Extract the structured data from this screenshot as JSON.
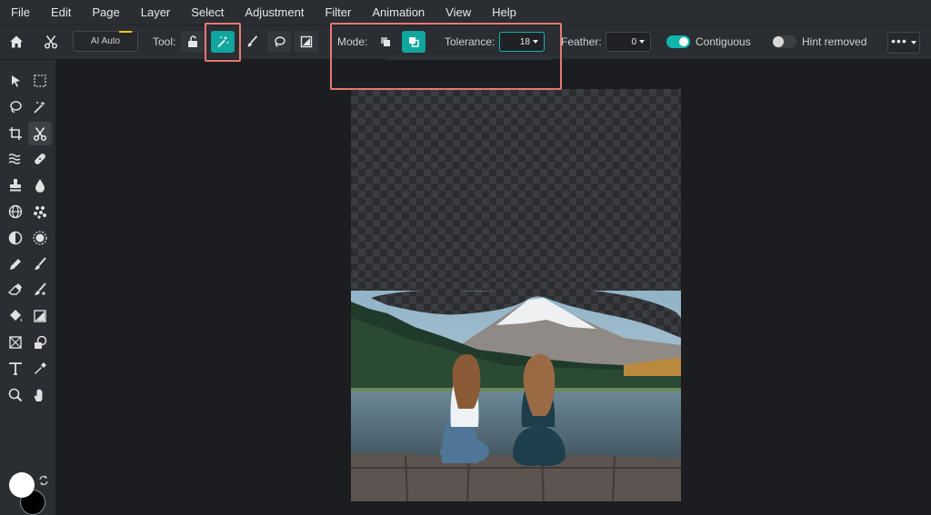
{
  "menu": [
    "File",
    "Edit",
    "Page",
    "Layer",
    "Select",
    "Adjustment",
    "Filter",
    "Animation",
    "View",
    "Help"
  ],
  "toolbar": {
    "ai_auto_label": "AI Auto",
    "tool_label": "Tool:",
    "mode_label": "Mode:",
    "tolerance_label": "Tolerance:",
    "tolerance_value": "18",
    "tolerance_max": 100,
    "feather_label": "Feather:",
    "feather_value": "0",
    "contiguous_label": "Contiguous",
    "contiguous_on": true,
    "hint_removed_label": "Hint removed",
    "hint_removed_on": false
  },
  "colors": {
    "accent": "#12b5ad",
    "highlight": "#e57a72",
    "foreground_swatch": "#ffffff",
    "background_swatch": "#000000"
  },
  "left_tools": [
    [
      "move-tool-icon",
      "marquee-select-icon"
    ],
    [
      "lasso-select-icon",
      "magic-wand-icon"
    ],
    [
      "crop-icon",
      "cutout-scissors-icon"
    ],
    [
      "liquify-icon",
      "healing-bandage-icon"
    ],
    [
      "clone-stamp-icon",
      "blur-drop-icon"
    ],
    [
      "filter-globe-icon",
      "effects-dots-icon"
    ],
    [
      "dodge-burn-icon",
      "sponge-sun-icon"
    ],
    [
      "pencil-icon",
      "brush-icon"
    ],
    [
      "eraser-icon",
      "color-replace-brush-icon"
    ],
    [
      "fill-bucket-icon",
      "gradient-icon"
    ],
    [
      "shape-frame-icon",
      "shapes-icon"
    ],
    [
      "text-tool-icon",
      "eyedropper-icon"
    ],
    [
      "zoom-icon",
      "hand-pan-icon"
    ]
  ],
  "selected_tool": "cutout-scissors-icon"
}
